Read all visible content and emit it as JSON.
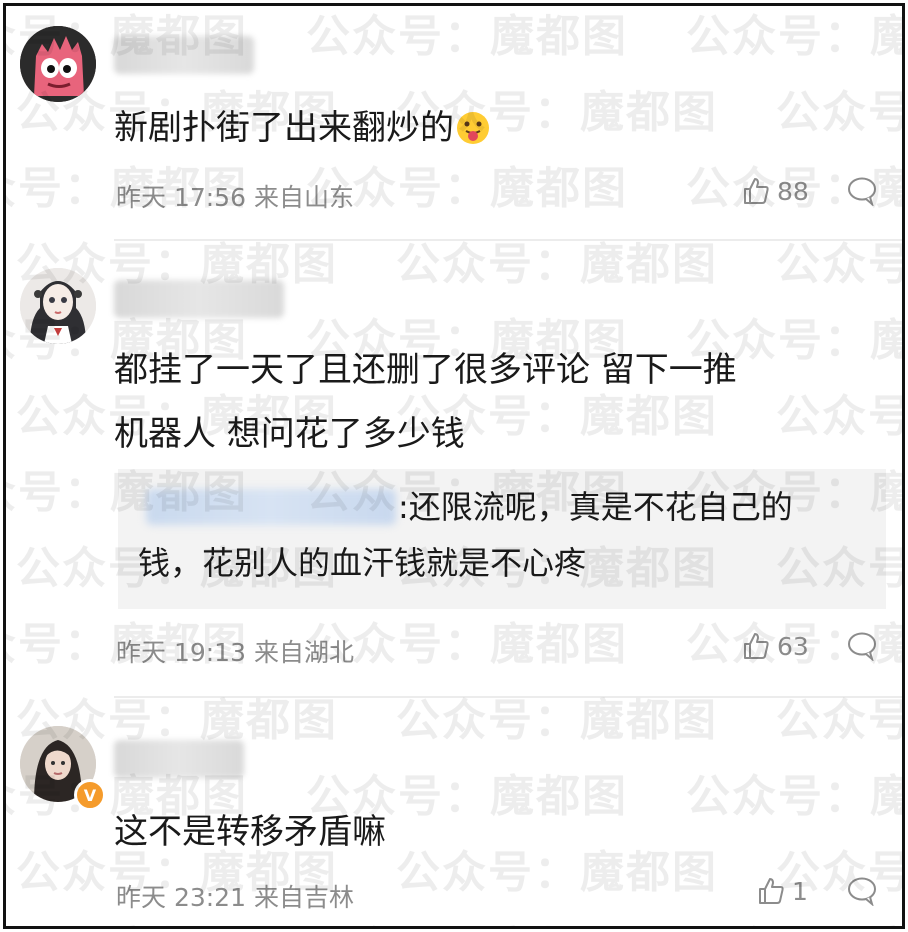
{
  "watermark_text": "公众号：魔都图",
  "comments": [
    {
      "text": "新剧扑街了出来翻炒的",
      "emoji": "tongue-out-emoji",
      "time": "昨天 17:56",
      "location": "来自山东",
      "likes": "88"
    },
    {
      "text_line1": "都挂了一天了且还删了很多评论 留下一推",
      "text_line2": "机器人 想问花了多少钱",
      "quote_line1": ":还限流呢，真是不花自己的",
      "quote_line2": "钱，花别人的血汗钱就是不心疼",
      "time": "昨天 19:13",
      "location": "来自湖北",
      "likes": "63"
    },
    {
      "text": "这不是转移矛盾嘛",
      "time": "昨天 23:21",
      "location": "来自吉林",
      "likes": "1",
      "badge": "V"
    }
  ],
  "colors": {
    "meta_gray": "#8c8c8c",
    "badge_orange": "#f59b2b",
    "quote_bg": "#f3f3f3"
  }
}
